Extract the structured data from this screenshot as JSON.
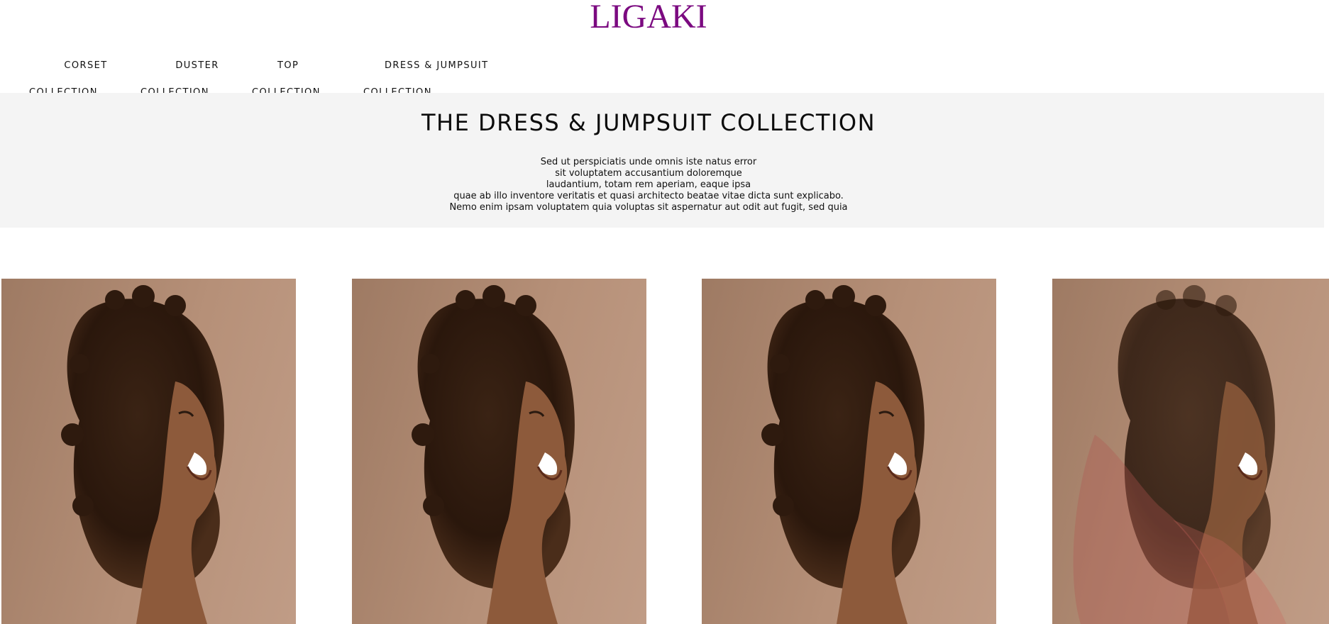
{
  "brand": {
    "name": "LIGAKI",
    "color": "#7b0a80"
  },
  "nav": {
    "items": [
      {
        "line1": "CORSET",
        "line2": "COLLECTION"
      },
      {
        "line1": "DUSTER",
        "line2": "COLLECTION"
      },
      {
        "line1": "TOP",
        "line2": "COLLECTION"
      },
      {
        "line1": "DRESS & JUMPSUIT",
        "line2": "COLLECTION"
      }
    ]
  },
  "banner": {
    "title": "THE DRESS & JUMPSUIT COLLECTION",
    "lines": [
      "Sed ut perspiciatis unde omnis iste natus error",
      "sit voluptatem accusantium doloremque",
      "laudantium, totam rem aperiam, eaque ipsa",
      "quae ab illo inventore veritatis et quasi architecto beatae vitae dicta sunt explicabo.",
      "Nemo enim ipsam voluptatem quia voluptas sit aspernatur aut odit aut fugit, sed quia"
    ],
    "background": "#f4f4f4"
  },
  "gallery": {
    "products": [
      {
        "image": "laughing-woman-curly-hair-photo"
      },
      {
        "image": "laughing-woman-curly-hair-photo"
      },
      {
        "image": "laughing-woman-curly-hair-photo"
      },
      {
        "image": "laughing-woman-curly-hair-photo-hover-crossfade"
      }
    ],
    "photo_background": "#b08a72"
  }
}
